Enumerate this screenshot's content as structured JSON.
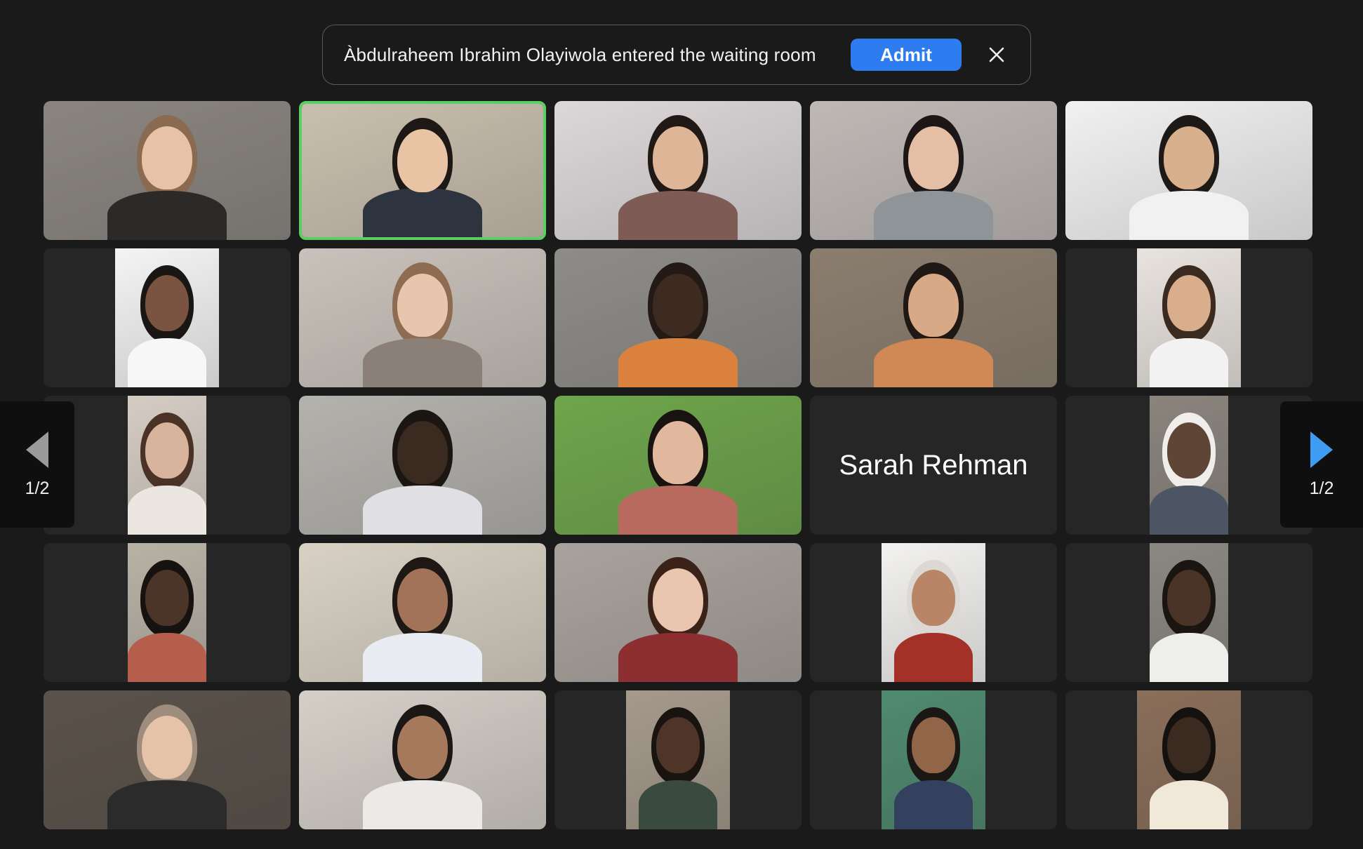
{
  "notification": {
    "message": "Àbdulraheem Ibrahim Olayiwola entered the waiting room",
    "admit_label": "Admit",
    "close_icon": "close-icon"
  },
  "pagination": {
    "prev_label": "1/2",
    "next_label": "1/2",
    "prev_icon": "triangle-left-icon",
    "next_icon": "triangle-right-icon"
  },
  "participants": [
    {
      "kind": "video",
      "shape": "full",
      "bg": "#8a8580",
      "skin": "#e7c2a6",
      "hair": "#8a6a50",
      "shirt": "#2b2a28",
      "active": false
    },
    {
      "kind": "video",
      "shape": "full",
      "bg": "#c9bfae",
      "skin": "#e8c4a4",
      "hair": "#1e1814",
      "shirt": "#2e3340",
      "active": true
    },
    {
      "kind": "video",
      "shape": "full",
      "bg": "#dcd7d8",
      "skin": "#dfb597",
      "hair": "#201915",
      "shirt": "#7f5b56",
      "active": false
    },
    {
      "kind": "video",
      "shape": "full",
      "bg": "#bfb9b6",
      "skin": "#e4bfa6",
      "hair": "#1c1716",
      "shirt": "#8f9499",
      "active": false
    },
    {
      "kind": "video",
      "shape": "full",
      "bg": "#f1f1f1",
      "skin": "#d9b08d",
      "hair": "#1d1917",
      "shirt": "#f1f1f1",
      "active": false
    },
    {
      "kind": "video",
      "shape": "portrait",
      "bg": "#f4f4f4",
      "skin": "#7a5440",
      "hair": "#1a1614",
      "shirt": "#f7f7f7",
      "active": false
    },
    {
      "kind": "video",
      "shape": "full",
      "bg": "#c9c2bb",
      "skin": "#e8c6ad",
      "hair": "#8d6c52",
      "shirt": "#8b8077",
      "active": false
    },
    {
      "kind": "video",
      "shape": "full",
      "bg": "#8e8c88",
      "skin": "#3d2a20",
      "hair": "#241a15",
      "shirt": "#d9813d",
      "active": false
    },
    {
      "kind": "video",
      "shape": "full",
      "bg": "#8b7e6f",
      "skin": "#d8a987",
      "hair": "#1f1815",
      "shirt": "#d08954",
      "active": false
    },
    {
      "kind": "video",
      "shape": "portrait",
      "bg": "#e8e3de",
      "skin": "#d9ae8d",
      "hair": "#3a2a1f",
      "shirt": "#f2f2f2",
      "active": false
    },
    {
      "kind": "video",
      "shape": "narrow",
      "bg": "#d5cdc4",
      "skin": "#d8b49c",
      "hair": "#4b3226",
      "shirt": "#ece6e0",
      "active": false
    },
    {
      "kind": "video",
      "shape": "full",
      "bg": "#b4b2ad",
      "skin": "#3a2a20",
      "hair": "#1c1612",
      "shirt": "#e0e0e4",
      "active": false
    },
    {
      "kind": "video",
      "shape": "full",
      "bg": "#6ea54b",
      "skin": "#e1b89e",
      "hair": "#181311",
      "shirt": "#b86a5e",
      "active": false
    },
    {
      "kind": "name",
      "name": "Sarah Rehman"
    },
    {
      "kind": "video",
      "shape": "narrow",
      "bg": "#8a847d",
      "skin": "#5e4536",
      "hair": "#efeeea",
      "shirt": "#4c5563",
      "active": false
    },
    {
      "kind": "video",
      "shape": "narrow",
      "bg": "#b8b2a6",
      "skin": "#4b3528",
      "hair": "#151210",
      "shirt": "#b65e4c",
      "active": false
    },
    {
      "kind": "video",
      "shape": "full",
      "bg": "#d8d1c4",
      "skin": "#a37359",
      "hair": "#1e1714",
      "shirt": "#e9edf3",
      "active": false
    },
    {
      "kind": "video",
      "shape": "full",
      "bg": "#a9a29d",
      "skin": "#eac6b0",
      "hair": "#3a2218",
      "shirt": "#8d2e31",
      "active": false
    },
    {
      "kind": "video",
      "shape": "portrait",
      "bg": "#f3f2f0",
      "skin": "#b88567",
      "hair": "#dcd9d4",
      "shirt": "#a33128",
      "active": false
    },
    {
      "kind": "video",
      "shape": "narrow",
      "bg": "#8b8881",
      "skin": "#4a3427",
      "hair": "#1b1512",
      "shirt": "#eeeeea",
      "active": false
    },
    {
      "kind": "video",
      "shape": "full",
      "bg": "#5a524a",
      "skin": "#e6c2a9",
      "hair": "#9e8c7c",
      "shirt": "#2c2b2c",
      "active": false
    },
    {
      "kind": "video",
      "shape": "full",
      "bg": "#d4cfc7",
      "skin": "#a6795c",
      "hair": "#1a1715",
      "shirt": "#eceae6",
      "active": false
    },
    {
      "kind": "video",
      "shape": "portrait",
      "bg": "#a59a8c",
      "skin": "#4e3528",
      "hair": "#1a1411",
      "shirt": "#3b4a3f",
      "active": false
    },
    {
      "kind": "video",
      "shape": "portrait",
      "bg": "#4f8a6f",
      "skin": "#916548",
      "hair": "#1b1715",
      "shirt": "#33405e",
      "active": false
    },
    {
      "kind": "video",
      "shape": "portrait",
      "bg": "#8a6f5a",
      "skin": "#3b2a20",
      "hair": "#15110f",
      "shirt": "#f0e8d8",
      "active": false
    }
  ]
}
